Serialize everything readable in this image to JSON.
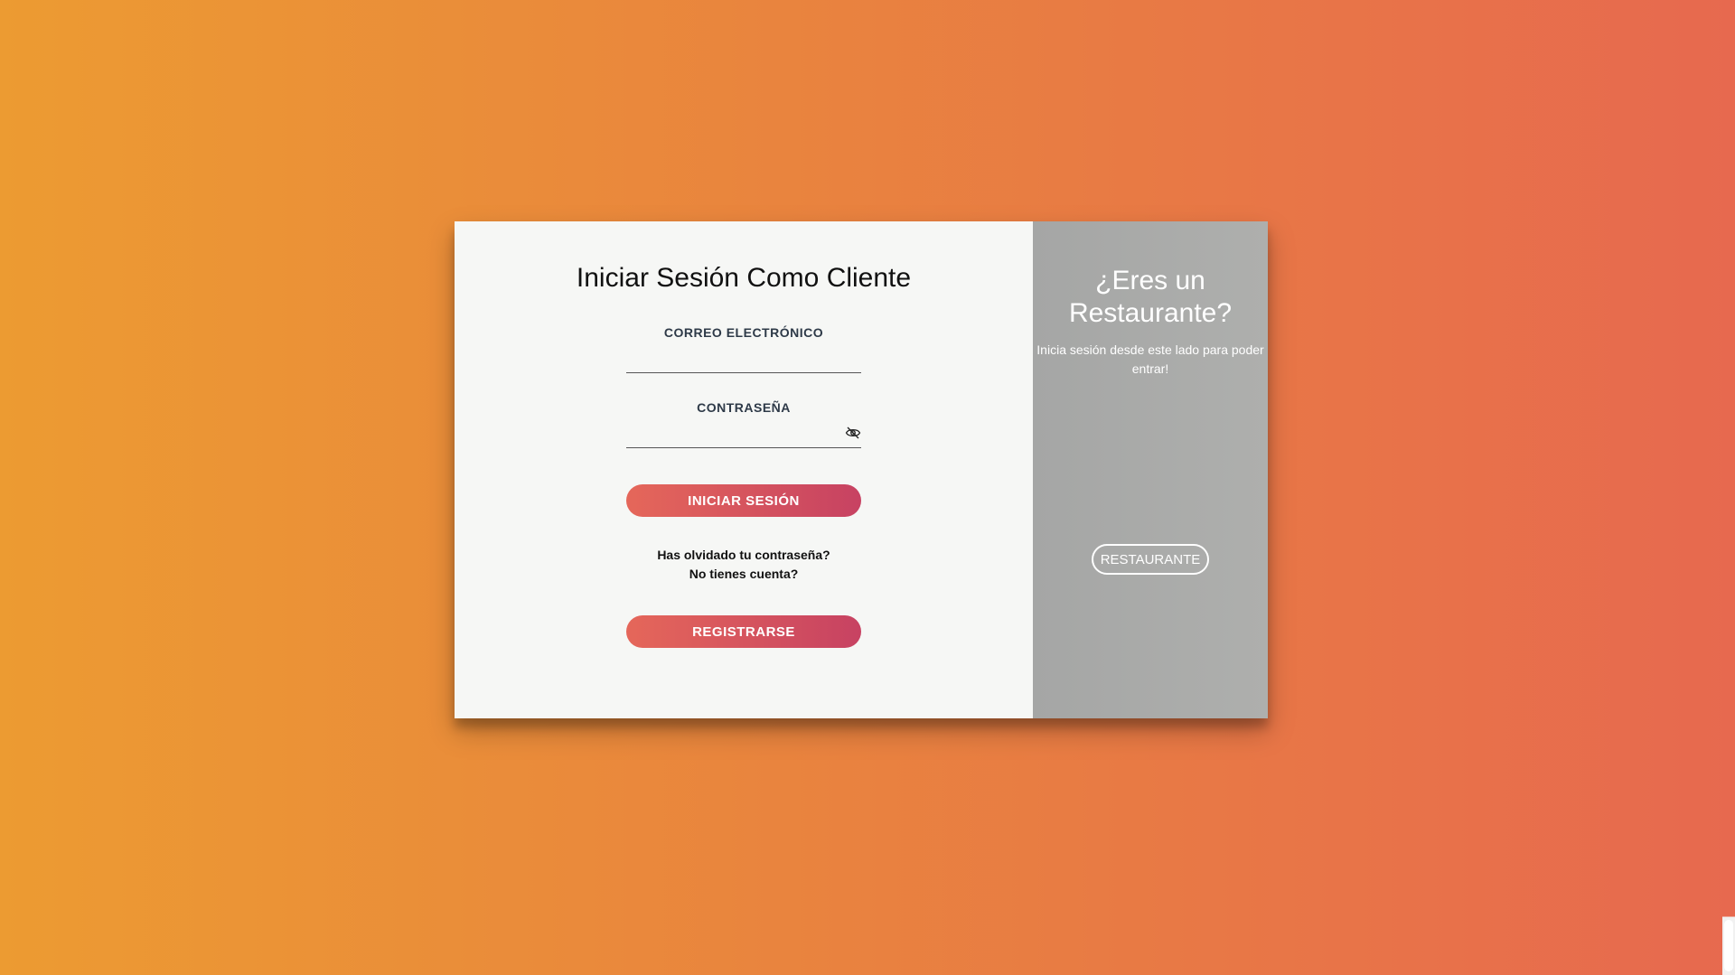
{
  "login": {
    "title": "Iniciar Sesión Como Cliente",
    "email_label": "CORREO ELECTRÓNICO",
    "email_value": "",
    "password_label": "CONTRASEÑA",
    "password_value": "",
    "login_button": "INICIAR SESIÓN",
    "forgot_link": "Has olvidado tu contraseña?",
    "no_account_link": "No tienes cuenta?",
    "register_button": "REGISTRARSE"
  },
  "restaurant_panel": {
    "title": "¿Eres un Restaurante?",
    "subtitle": "Inicia sesión desde este lado para poder entrar!",
    "button": "RESTAURANTE"
  },
  "icons": {
    "password_toggle": "eye-slash-icon"
  },
  "colors": {
    "background_start": "#ec9b32",
    "background_end": "#e7694f",
    "button_start": "#e5675a",
    "button_end": "#c74262",
    "right_panel": "#a9aaa9",
    "left_panel": "#f6f7f5"
  }
}
